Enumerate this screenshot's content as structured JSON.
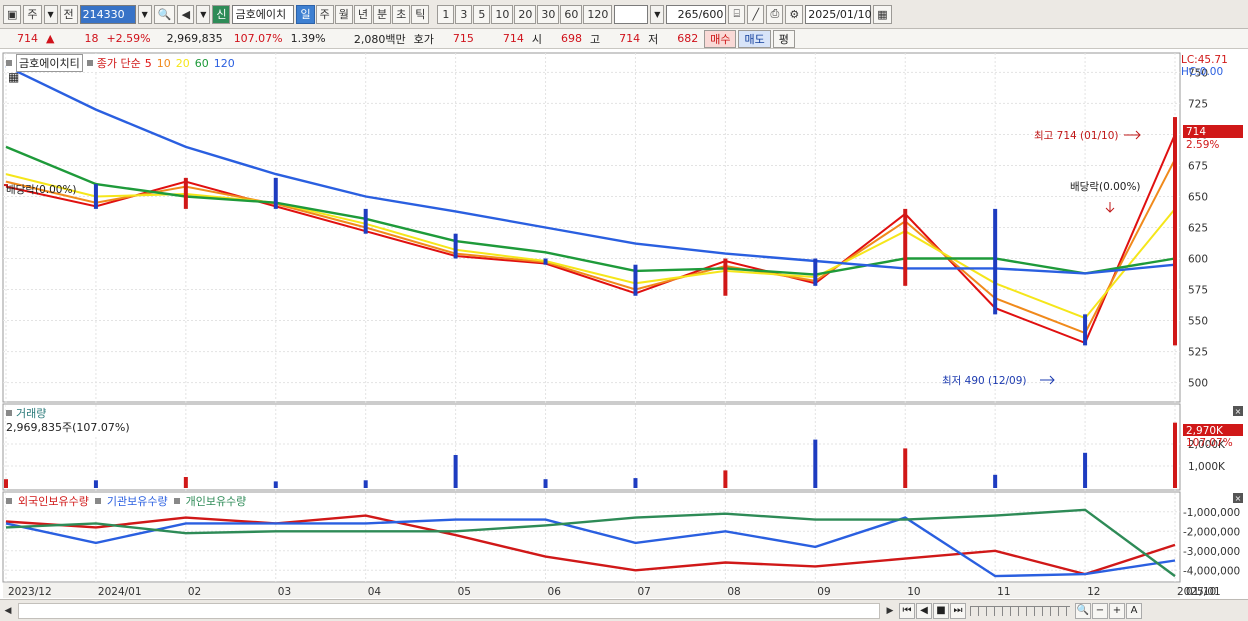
{
  "toolbar": {
    "market_type": "주",
    "market_mode": "전",
    "code": "214330",
    "sin_label": "신",
    "stock_name": "금호에이치",
    "periods": [
      "일",
      "주",
      "월",
      "년",
      "분",
      "초",
      "틱"
    ],
    "active_period": "일",
    "intervals": [
      "1",
      "3",
      "5",
      "10",
      "20",
      "30",
      "60",
      "120"
    ],
    "count_current": "265",
    "count_total": "/600",
    "date": "2025/01/10"
  },
  "quote": {
    "price": "714",
    "arrow": "▲",
    "change": "18",
    "change_pct": "+2.59%",
    "volume": "2,969,835",
    "vol_ratio": "107.07%",
    "turnover": "1.39%",
    "amount": "2,080백만",
    "hoga_label": "호가",
    "hoga_ask": "715",
    "hoga_bid": "714",
    "open_label": "시",
    "open": "698",
    "high_label": "고",
    "high": "714",
    "low_label": "저",
    "low": "682",
    "buy_label": "매수",
    "sell_label": "매도",
    "avg_label": "평"
  },
  "price_panel": {
    "name": "금호에이치티",
    "indicator_label": "종가 단순",
    "ma_labels": [
      {
        "label": "5",
        "color": "#e01010"
      },
      {
        "label": "10",
        "color": "#f08a1c"
      },
      {
        "label": "20",
        "color": "#f5e61a"
      },
      {
        "label": "60",
        "color": "#1e9a3a"
      },
      {
        "label": "120",
        "color": "#2a5fe0"
      }
    ],
    "lc_label": "LC:45.71",
    "hc_label": "HC:0.00",
    "y_ticks": [
      "750",
      "725",
      "700",
      "675",
      "650",
      "625",
      "600",
      "575",
      "550",
      "525",
      "500"
    ],
    "current_price_tag": "714",
    "current_pct_tag": "2.59%",
    "annotation_high": "최고 714 (01/10)",
    "annotation_low": "최저 490 (12/09)",
    "annotation_div_left": "배당락(0.00%)",
    "annotation_div_right": "배당락(0.00%)"
  },
  "volume_panel": {
    "name": "거래량",
    "value_label": "2,969,835주(107.07%)",
    "tag_value": "2,970K",
    "tag_pct": "107.07%",
    "y_ticks": [
      "2,000K",
      "1,000K"
    ]
  },
  "holding_panel": {
    "series_labels": [
      {
        "label": "외국인보유수량",
        "color": "#d01818"
      },
      {
        "label": "기관보유수량",
        "color": "#2a5fe0"
      },
      {
        "label": "개인보유수량",
        "color": "#2e8b57"
      }
    ],
    "y_ticks": [
      "-1,000,000",
      "-2,000,000",
      "-3,000,000",
      "-4,000,000"
    ]
  },
  "x_axis": {
    "labels": [
      "2023/12",
      "2024/01",
      "02",
      "03",
      "04",
      "05",
      "06",
      "07",
      "08",
      "09",
      "10",
      "11",
      "12",
      "2025/01"
    ],
    "right_label": "01/10"
  },
  "chart_data": [
    {
      "type": "line",
      "title": "금호에이치티",
      "ylim": [
        490,
        760
      ],
      "x": [
        "2023/12",
        "2024/01",
        "02",
        "03",
        "04",
        "05",
        "06",
        "07",
        "08",
        "09",
        "10",
        "11",
        "12",
        "2025/01"
      ],
      "series": [
        {
          "name": "종가",
          "values": [
            660,
            640,
            665,
            640,
            620,
            600,
            595,
            570,
            600,
            578,
            640,
            555,
            530,
            714
          ]
        },
        {
          "name": "5",
          "values": [
            658,
            642,
            662,
            642,
            622,
            602,
            596,
            572,
            598,
            580,
            636,
            560,
            532,
            700
          ]
        },
        {
          "name": "10",
          "values": [
            662,
            645,
            658,
            644,
            625,
            604,
            597,
            575,
            594,
            582,
            630,
            568,
            540,
            680
          ]
        },
        {
          "name": "20",
          "values": [
            668,
            650,
            652,
            645,
            628,
            607,
            598,
            580,
            590,
            585,
            622,
            580,
            552,
            640
          ]
        },
        {
          "name": "60",
          "values": [
            690,
            660,
            650,
            645,
            632,
            614,
            605,
            590,
            592,
            587,
            600,
            600,
            588,
            600
          ]
        },
        {
          "name": "120",
          "values": [
            755,
            720,
            690,
            668,
            650,
            638,
            625,
            612,
            604,
            598,
            592,
            592,
            588,
            595
          ]
        }
      ]
    },
    {
      "type": "bar",
      "title": "거래량",
      "ylim": [
        0,
        3000000
      ],
      "categories": [
        "2023/12",
        "2024/01",
        "02",
        "03",
        "04",
        "05",
        "06",
        "07",
        "08",
        "09",
        "10",
        "11",
        "12",
        "2025/01"
      ],
      "values": [
        400000,
        350000,
        500000,
        300000,
        350000,
        1500000,
        400000,
        450000,
        800000,
        2200000,
        1800000,
        600000,
        1600000,
        2969835
      ]
    },
    {
      "type": "line",
      "title": "보유수량",
      "ylim": [
        -4500000,
        -500000
      ],
      "x": [
        "2023/12",
        "2024/01",
        "02",
        "03",
        "04",
        "05",
        "06",
        "07",
        "08",
        "09",
        "10",
        "11",
        "12",
        "2025/01"
      ],
      "series": [
        {
          "name": "외국인보유수량",
          "values": [
            -1500000,
            -1800000,
            -1300000,
            -1600000,
            -1200000,
            -2200000,
            -3300000,
            -4000000,
            -3600000,
            -3800000,
            -3400000,
            -3000000,
            -4200000,
            -2700000
          ]
        },
        {
          "name": "기관보유수량",
          "values": [
            -1600000,
            -2600000,
            -1600000,
            -1600000,
            -1600000,
            -1400000,
            -1400000,
            -2600000,
            -2000000,
            -2800000,
            -1300000,
            -4300000,
            -4200000,
            -3500000
          ]
        },
        {
          "name": "개인보유수량",
          "values": [
            -1800000,
            -1600000,
            -2100000,
            -2000000,
            -2000000,
            -2000000,
            -1700000,
            -1300000,
            -1100000,
            -1400000,
            -1400000,
            -1200000,
            -900000,
            -4300000
          ]
        }
      ]
    }
  ]
}
